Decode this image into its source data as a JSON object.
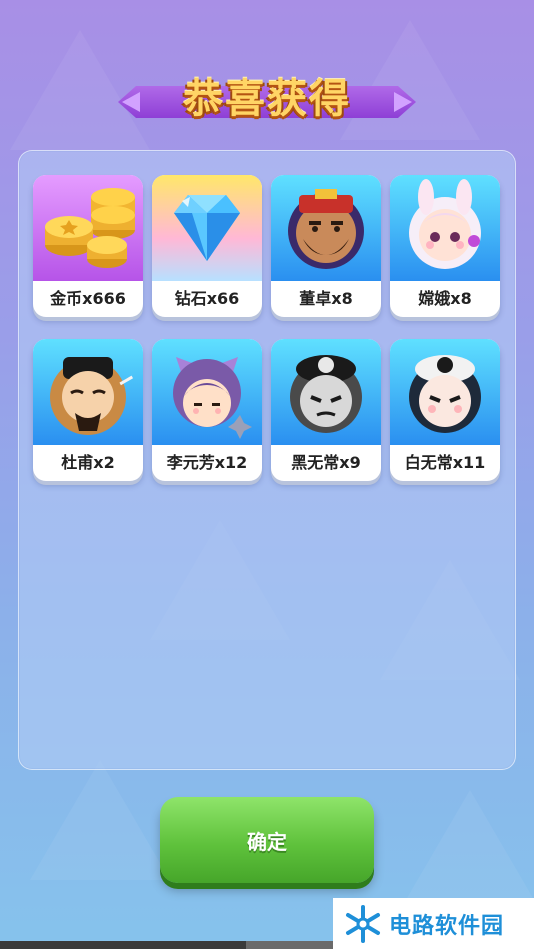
{
  "title": "恭喜获得",
  "rewards": [
    {
      "label": "金币x666",
      "icon": "gold-coins-icon"
    },
    {
      "label": "钻石x66",
      "icon": "diamond-icon"
    },
    {
      "label": "董卓x8",
      "icon": "dongzhuo-avatar"
    },
    {
      "label": "嫦娥x8",
      "icon": "change-avatar"
    },
    {
      "label": "杜甫x2",
      "icon": "dufu-avatar"
    },
    {
      "label": "李元芳x12",
      "icon": "liyuanfang-avatar"
    },
    {
      "label": "黑无常x9",
      "icon": "heiwuchang-avatar"
    },
    {
      "label": "白无常x11",
      "icon": "baiwuchang-avatar"
    }
  ],
  "confirm_label": "确定",
  "watermark": {
    "text": "电路软件园",
    "icon": "snowflake-logo-icon"
  },
  "colors": {
    "confirm": "#5fc23c",
    "title_text": "#ffd565",
    "ribbon": "#9a48dc"
  }
}
